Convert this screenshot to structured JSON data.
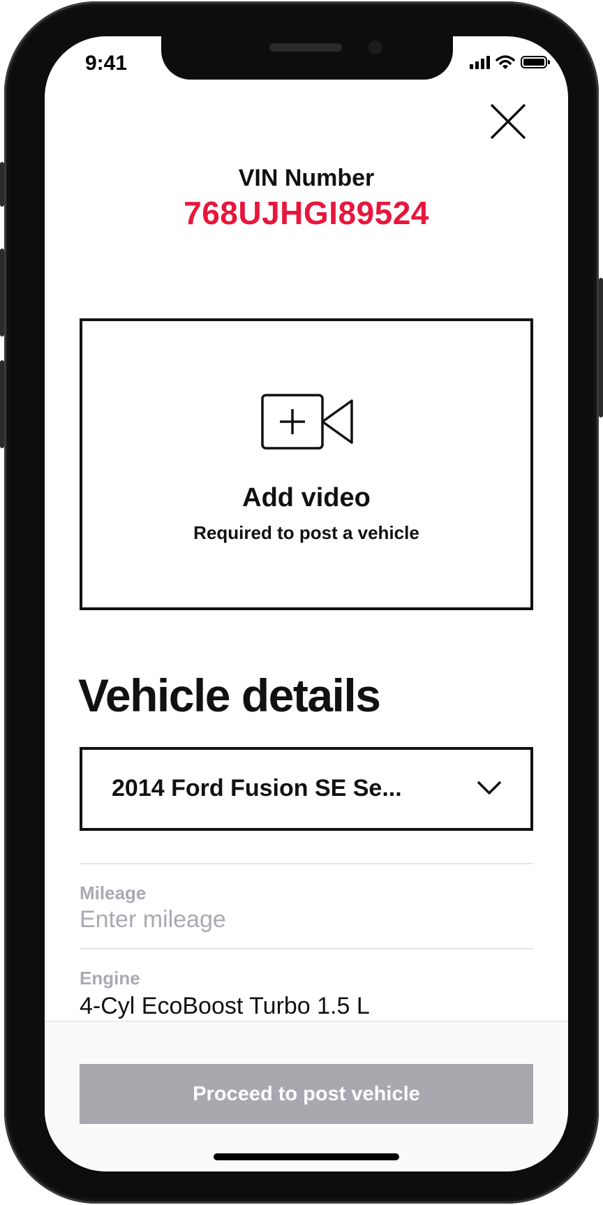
{
  "status_bar": {
    "time": "9:41"
  },
  "vin": {
    "label": "VIN Number",
    "value": "768UJHGI89524"
  },
  "video": {
    "title": "Add video",
    "subtitle": "Required to post a vehicle"
  },
  "vehicle_details": {
    "title": "Vehicle details",
    "selected_vehicle": "2014 Ford Fusion SE Se...",
    "mileage": {
      "label": "Mileage",
      "placeholder": "Enter mileage",
      "value": ""
    },
    "engine": {
      "label": "Engine",
      "value": "4-Cyl EcoBoost Turbo 1.5 L"
    }
  },
  "footer": {
    "proceed_label": "Proceed to post vehicle"
  },
  "colors": {
    "accent": "#e8163c",
    "disabled_button": "#a8a8ae",
    "muted_label": "#a9a9b2"
  }
}
